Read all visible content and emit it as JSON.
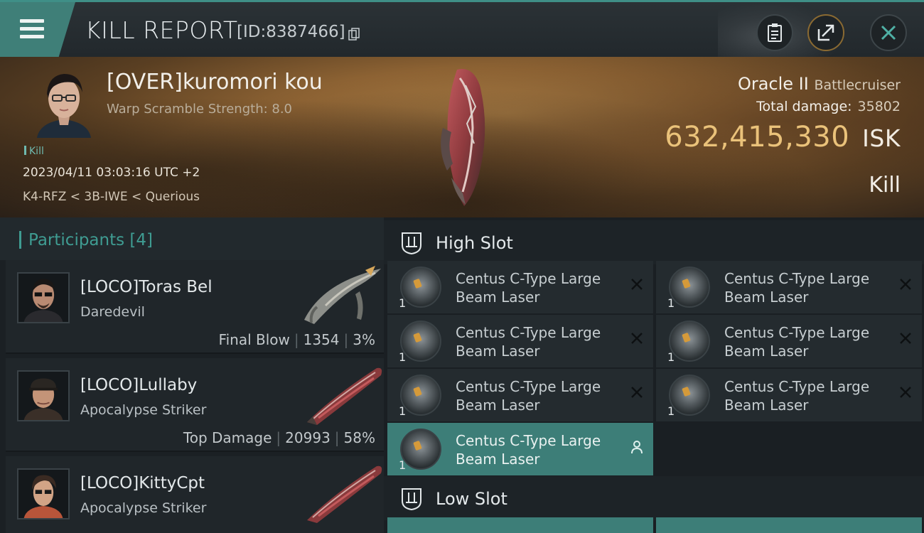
{
  "window": {
    "title": "KILL REPORT",
    "id": "[ID:8387466]"
  },
  "victim": {
    "name": "[OVER]kuromori kou",
    "detail": "Warp Scramble Strength: 8.0",
    "tag": "Kill",
    "timestamp": "2023/04/11 03:03:16 UTC +2",
    "location": "K4-RFZ < 3B-IWE < Querious",
    "ship": "Oracle II",
    "ship_class": "Battlecruiser",
    "total_damage_label": "Total damage:",
    "total_damage": "35802",
    "isk_value": "632,415,330",
    "isk_unit": "ISK",
    "result": "Kill"
  },
  "participants": {
    "title": "Participants",
    "count": "[4]",
    "rows": [
      {
        "name": "[LOCO]Toras Bel",
        "ship": "Daredevil",
        "stat_label": "Final Blow",
        "damage": "1354",
        "percent": "3%"
      },
      {
        "name": "[LOCO]Lullaby",
        "ship": "Apocalypse Striker",
        "stat_label": "Top Damage",
        "damage": "20993",
        "percent": "58%"
      },
      {
        "name": "[LOCO]KittyCpt",
        "ship": "Apocalypse Striker",
        "stat_label": "",
        "damage": "",
        "percent": ""
      }
    ]
  },
  "fitting": {
    "high_slot_title": "High Slot",
    "low_slot_title": "Low Slot",
    "modules": [
      {
        "line1": "Centus C-Type Large",
        "line2": "Beam Laser",
        "qty": "1"
      },
      {
        "line1": "Centus C-Type Large",
        "line2": "Beam Laser",
        "qty": "1"
      },
      {
        "line1": "Centus C-Type Large",
        "line2": "Beam Laser",
        "qty": "1"
      },
      {
        "line1": "Centus C-Type Large",
        "line2": "Beam Laser",
        "qty": "1"
      },
      {
        "line1": "Centus C-Type Large",
        "line2": "Beam Laser",
        "qty": "1"
      },
      {
        "line1": "Centus C-Type Large",
        "line2": "Beam Laser",
        "qty": "1"
      },
      {
        "line1": "Centus C-Type Large",
        "line2": "Beam Laser",
        "qty": "1"
      }
    ]
  },
  "colors": {
    "accent": "#3f9c92",
    "isk_gold": "#eac27a",
    "active_module": "#3d7e78"
  }
}
